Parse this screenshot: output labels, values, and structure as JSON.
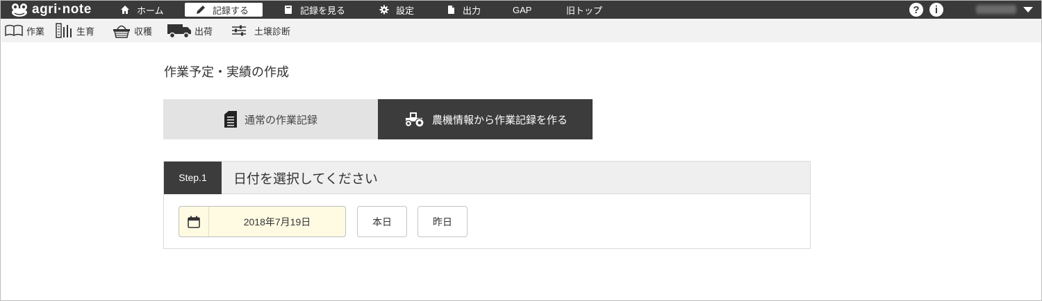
{
  "app": {
    "logo_text": "agri·note"
  },
  "top_nav": {
    "items": [
      {
        "label": "ホーム",
        "icon": "home-icon"
      },
      {
        "label": "記録する",
        "icon": "pencil-icon",
        "active": true
      },
      {
        "label": "記録を見る",
        "icon": "book-icon"
      },
      {
        "label": "設定",
        "icon": "gear-icon"
      },
      {
        "label": "出力",
        "icon": "file-icon"
      },
      {
        "label": "GAP"
      },
      {
        "label": "旧トップ"
      }
    ],
    "help_icon_text": "?",
    "info_icon_text": "i"
  },
  "sub_nav": {
    "items": [
      {
        "label": "作業",
        "icon": "open-book-icon"
      },
      {
        "label": "生育",
        "icon": "growth-bars-icon"
      },
      {
        "label": "収穫",
        "icon": "basket-icon"
      },
      {
        "label": "出荷",
        "icon": "truck-icon"
      },
      {
        "label": "土壌診断",
        "icon": "sliders-icon"
      }
    ]
  },
  "main": {
    "title": "作業予定・実績の作成",
    "tabs": [
      {
        "label": "通常の作業記録",
        "icon": "document-icon"
      },
      {
        "label": "農機情報から作業記録を作る",
        "icon": "tractor-icon",
        "selected": true
      }
    ],
    "step": {
      "badge": "Step.1",
      "title": "日付を選択してください",
      "date_value": "2018年7月19日",
      "today_button": "本日",
      "yesterday_button": "昨日"
    }
  },
  "colors": {
    "topbar_bg": "#3a3a3a",
    "subbar_bg": "#f2f2f2",
    "selected_tab_bg": "#3c3c3c",
    "date_field_bg": "#fffbe3"
  }
}
